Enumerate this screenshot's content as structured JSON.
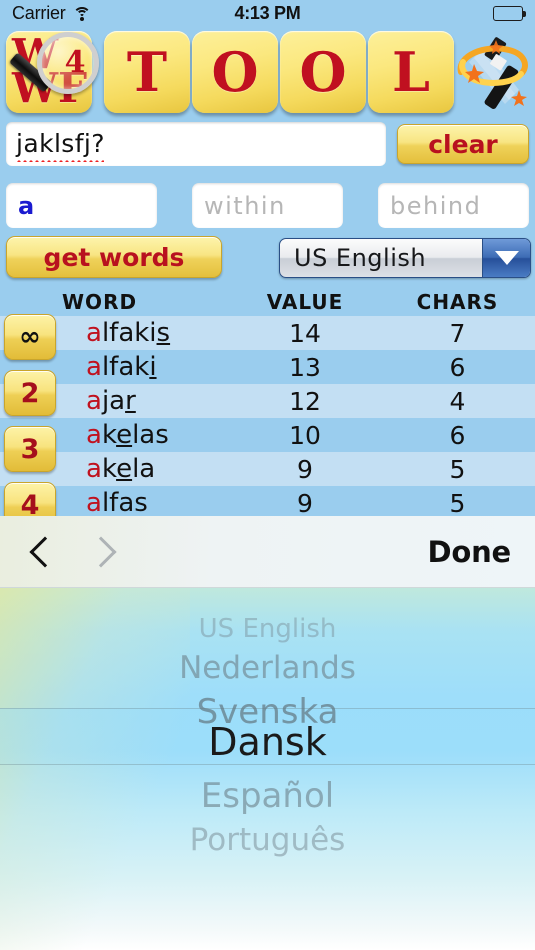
{
  "status_bar": {
    "carrier": "Carrier",
    "wifi_icon": "wifi-icon",
    "time": "4:13 PM",
    "battery_icon": "battery-full-icon"
  },
  "logo": {
    "tile_line1": "W",
    "tile_line2": "WF",
    "magnifier_badge": "4",
    "letters": [
      "T",
      "O",
      "O",
      "L"
    ],
    "wand_icon": "magic-wand-icon"
  },
  "search": {
    "value": "jaklsfj?",
    "clear_label": "clear"
  },
  "filters": {
    "letters_value": "a",
    "within_placeholder": "within",
    "behind_placeholder": "behind"
  },
  "actions": {
    "get_words_label": "get words",
    "language_selected": "US English",
    "dropdown_arrow_icon": "chevron-down-icon"
  },
  "results": {
    "headers": {
      "word": "WORD",
      "value": "VALUE",
      "chars": "CHARS"
    },
    "badges": [
      "∞",
      "2",
      "3",
      "4"
    ],
    "rows": [
      {
        "prefix": "a",
        "mid": "lfaki",
        "underlined": "s",
        "suffix": "",
        "word": "alfakis",
        "value": "14",
        "chars": "7"
      },
      {
        "prefix": "a",
        "mid": "lfak",
        "underlined": "i",
        "suffix": "",
        "word": "alfaki",
        "value": "13",
        "chars": "6"
      },
      {
        "prefix": "a",
        "mid": "ja",
        "underlined": "r",
        "suffix": "",
        "word": "ajar",
        "value": "12",
        "chars": "4"
      },
      {
        "prefix": "a",
        "mid": "k",
        "underlined": "e",
        "suffix": "las",
        "word": "akelas",
        "value": "10",
        "chars": "6"
      },
      {
        "prefix": "a",
        "mid": "k",
        "underlined": "e",
        "suffix": "la",
        "word": "akela",
        "value": "9",
        "chars": "5"
      },
      {
        "prefix": "a",
        "mid": "lfas",
        "underlined": "",
        "suffix": "",
        "word": "alfas",
        "value": "9",
        "chars": "5"
      }
    ]
  },
  "picker": {
    "back_icon": "chevron-left-icon",
    "forward_icon": "chevron-right-icon",
    "done_label": "Done",
    "options": [
      "US English",
      "Nederlands",
      "Svenska",
      "Dansk",
      "Español",
      "Português"
    ],
    "selected": "Dansk",
    "selected_index": 3
  },
  "colors": {
    "background": "#9acdee",
    "tile_yellow": "#f5da5d",
    "tile_red": "#c01020",
    "row_odd": "#c3dff3",
    "row_even": "#9acdee",
    "dropdown_blue": "#2a4f86",
    "input_blue_text": "#1a1ad0",
    "spellcheck_red": "#ee2222"
  }
}
